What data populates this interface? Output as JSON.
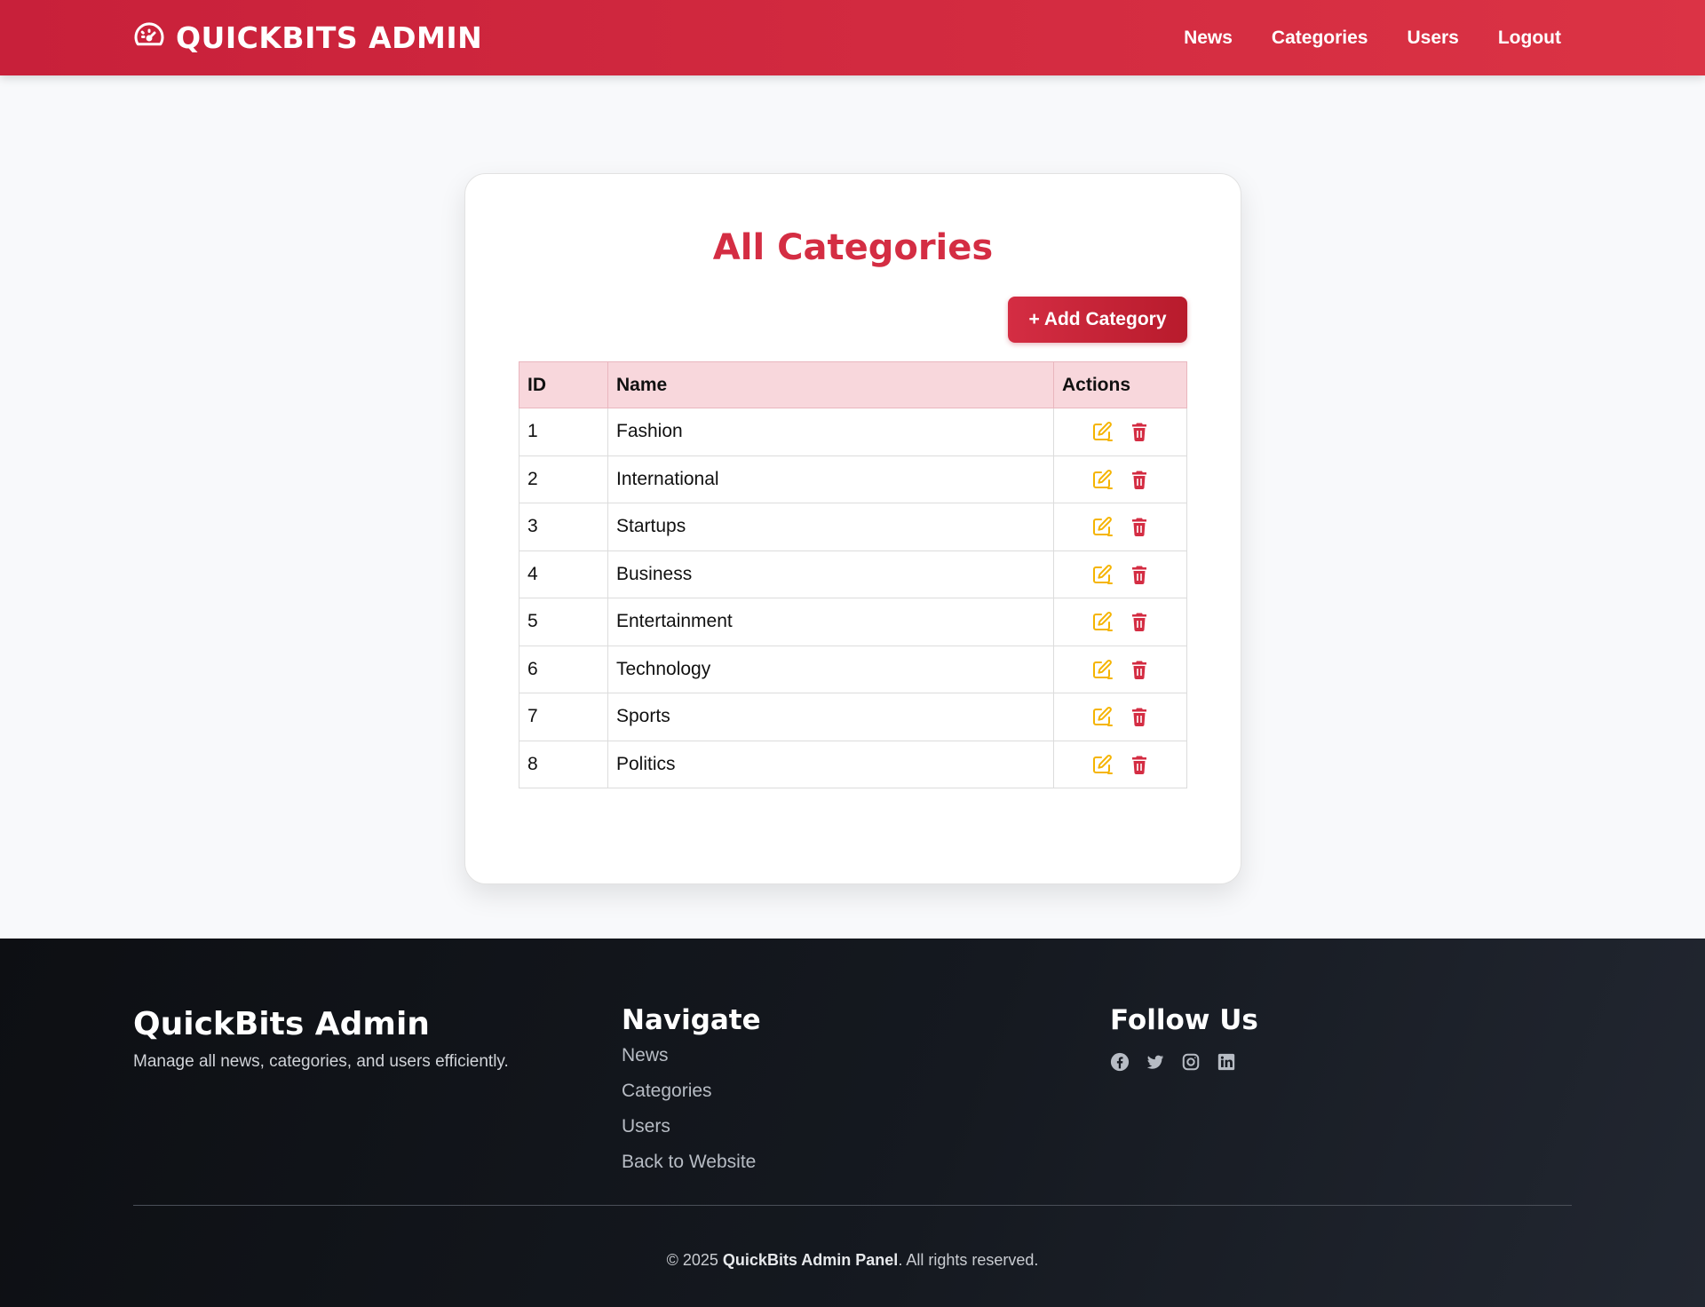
{
  "header": {
    "brand": "QUICKBITS ADMIN",
    "brand_icon": "dashboard-gauge-icon",
    "nav": [
      "News",
      "Categories",
      "Users",
      "Logout"
    ]
  },
  "main": {
    "title": "All Categories",
    "add_button": "+ Add Category",
    "columns": [
      "ID",
      "Name",
      "Actions"
    ],
    "rows": [
      {
        "id": "1",
        "name": "Fashion"
      },
      {
        "id": "2",
        "name": "International"
      },
      {
        "id": "3",
        "name": "Startups"
      },
      {
        "id": "4",
        "name": "Business"
      },
      {
        "id": "5",
        "name": "Entertainment"
      },
      {
        "id": "6",
        "name": "Technology"
      },
      {
        "id": "7",
        "name": "Sports"
      },
      {
        "id": "8",
        "name": "Politics"
      }
    ],
    "row_action_icons": [
      "edit-icon",
      "trash-icon"
    ]
  },
  "footer": {
    "brand": "QuickBits Admin",
    "description": "Manage all news, categories, and users efficiently.",
    "navigate_heading": "Navigate",
    "navigate_links": [
      "News",
      "Categories",
      "Users",
      "Back to Website"
    ],
    "follow_heading": "Follow Us",
    "social_icons": [
      "facebook-icon",
      "twitter-icon",
      "instagram-icon",
      "linkedin-icon"
    ],
    "copyright_prefix": "© 2025 ",
    "copyright_bold": "QuickBits Admin Panel",
    "copyright_suffix": ". All rights reserved."
  },
  "colors": {
    "primary": "#d42d43",
    "header_bg": "#c8203a",
    "table_header_bg": "#f8d7dc",
    "edit_icon": "#f5b400",
    "delete_icon": "#d42d43",
    "footer_bg": "#151920"
  }
}
